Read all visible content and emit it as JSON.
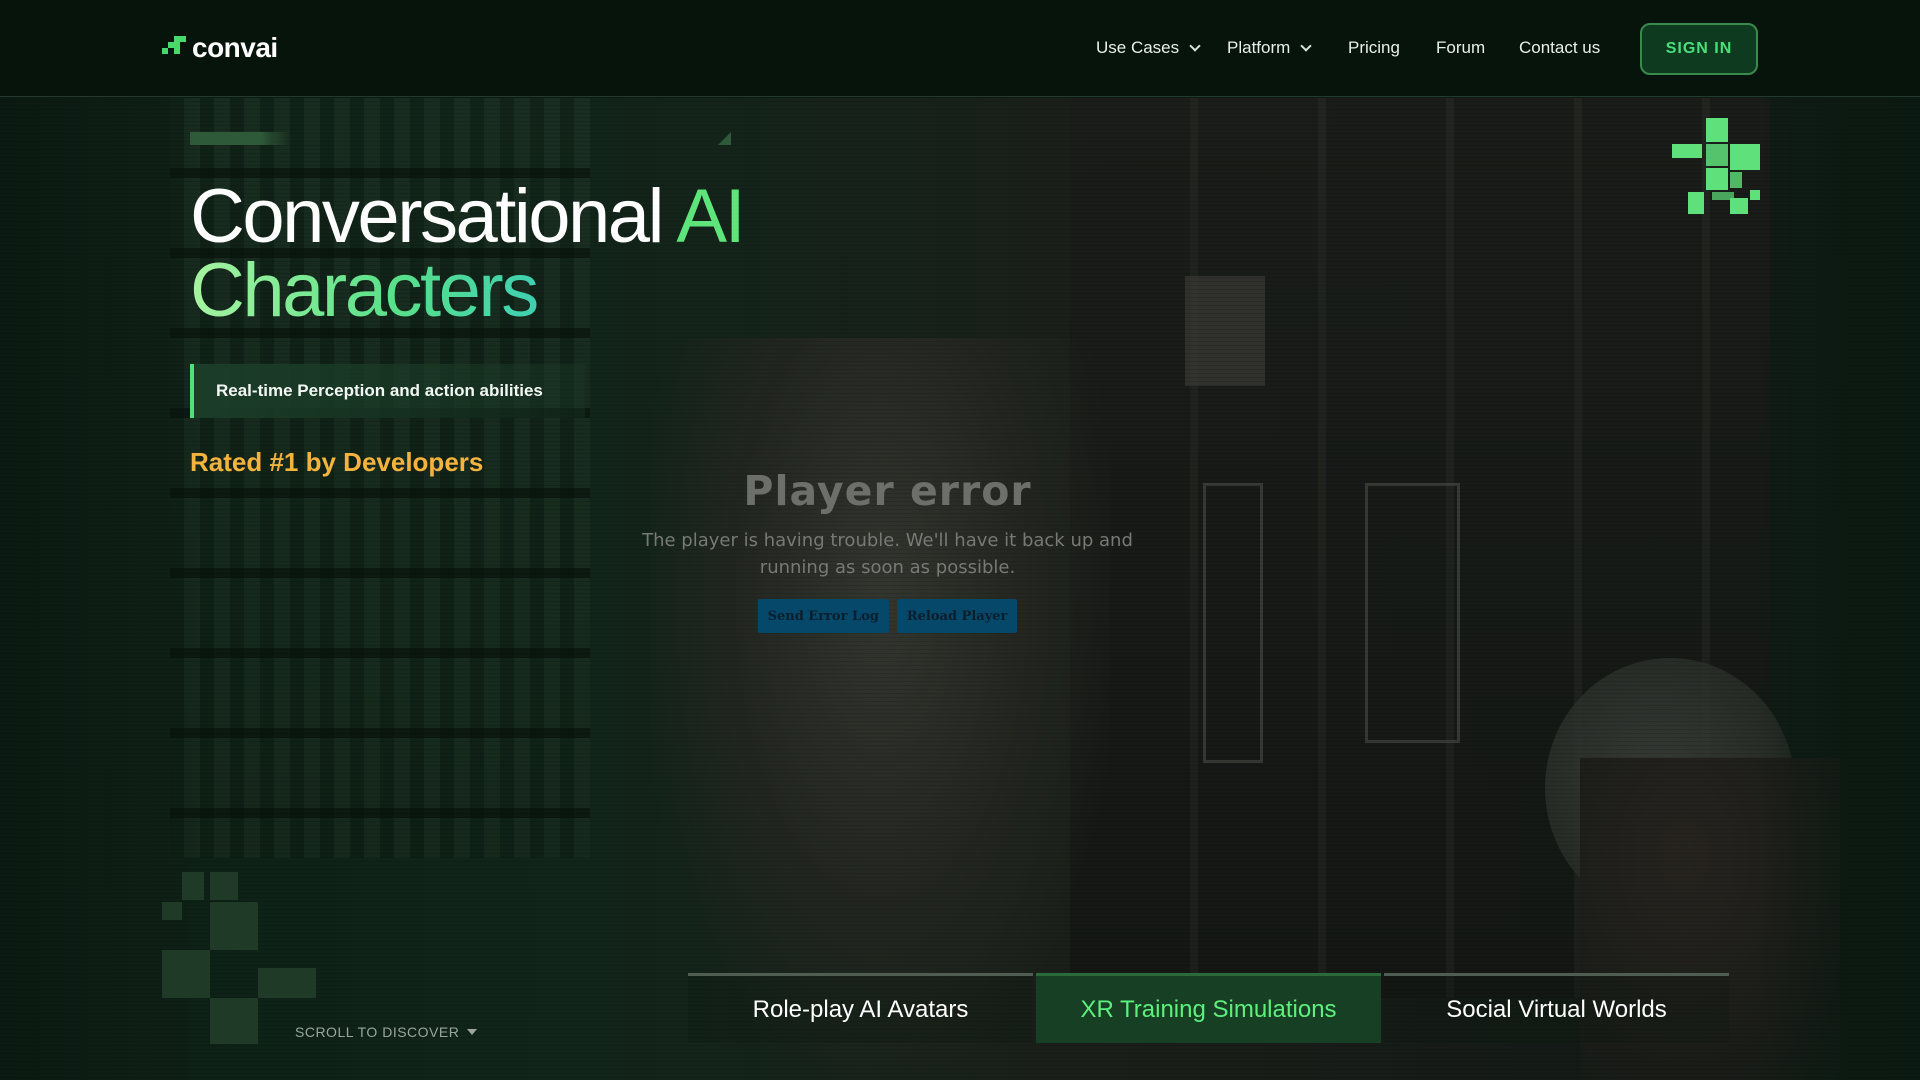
{
  "brand": {
    "name": "convai",
    "accent": "#48d96c"
  },
  "nav": {
    "items": [
      {
        "label": "Use Cases",
        "dropdown": true
      },
      {
        "label": "Platform",
        "dropdown": true
      },
      {
        "label": "Pricing",
        "dropdown": false
      },
      {
        "label": "Forum",
        "dropdown": false
      },
      {
        "label": "Contact us",
        "dropdown": false
      }
    ],
    "signin_label": "SIGN IN"
  },
  "hero": {
    "title_line1_white": "Conversational ",
    "title_line1_green": "AI",
    "title_line2": "Characters",
    "feature": "Real-time Perception and action abilities",
    "rated": "Rated #1 by Developers"
  },
  "player": {
    "error_title": "Player error",
    "error_message": "The player is having trouble. We'll have it back up and running as soon as possible.",
    "send_log_label": "Send Error Log",
    "reload_label": "Reload Player"
  },
  "tabs": [
    {
      "label": "Role-play AI Avatars",
      "active": false
    },
    {
      "label": "XR Training Simulations",
      "active": true
    },
    {
      "label": "Social Virtual Worlds",
      "active": false
    }
  ],
  "scroll_hint": "SCROLL TO DISCOVER",
  "colors": {
    "background": "#0b1a12",
    "header": "#06140c",
    "rated": "#f4b33d",
    "active_tab": "#5ef07d",
    "signin_text": "#48e07a"
  }
}
